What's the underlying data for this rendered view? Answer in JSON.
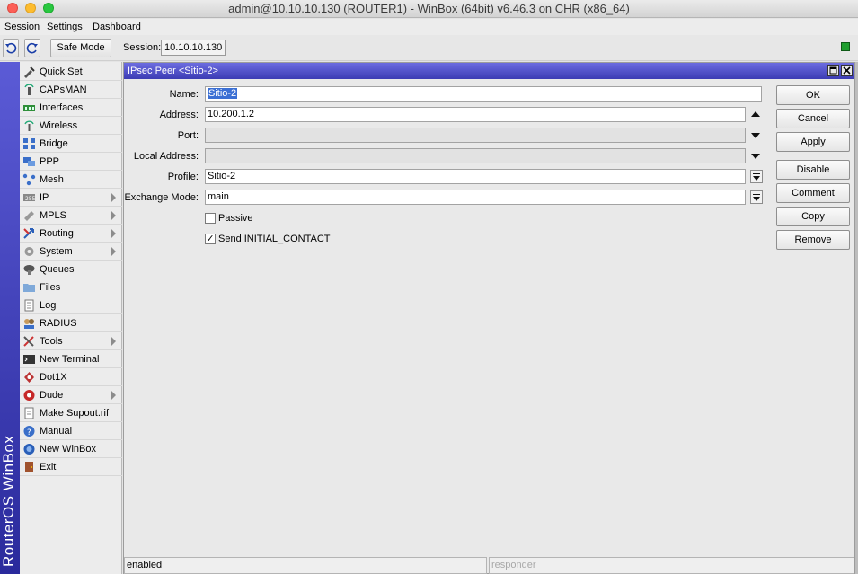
{
  "window": {
    "title": "admin@10.10.10.130 (ROUTER1) - WinBox (64bit) v6.46.3 on CHR (x86_64)"
  },
  "menubar": {
    "items": [
      "Session",
      "Settings",
      "Dashboard"
    ]
  },
  "toolbar": {
    "undo_icon": "undo-icon",
    "redo_icon": "redo-icon",
    "safe_mode_label": "Safe Mode",
    "session_label": "Session:",
    "session_value": "10.10.10.130"
  },
  "brand": {
    "text": "RouterOS WinBox"
  },
  "sidebar": {
    "items": [
      {
        "label": "Quick Set",
        "icon": "quickset-icon",
        "submenu": false
      },
      {
        "label": "CAPsMAN",
        "icon": "capsman-icon",
        "submenu": false
      },
      {
        "label": "Interfaces",
        "icon": "interfaces-icon",
        "submenu": false
      },
      {
        "label": "Wireless",
        "icon": "wireless-icon",
        "submenu": false
      },
      {
        "label": "Bridge",
        "icon": "bridge-icon",
        "submenu": false
      },
      {
        "label": "PPP",
        "icon": "ppp-icon",
        "submenu": false
      },
      {
        "label": "Mesh",
        "icon": "mesh-icon",
        "submenu": false
      },
      {
        "label": "IP",
        "icon": "ip-icon",
        "submenu": true
      },
      {
        "label": "MPLS",
        "icon": "mpls-icon",
        "submenu": true
      },
      {
        "label": "Routing",
        "icon": "routing-icon",
        "submenu": true
      },
      {
        "label": "System",
        "icon": "system-icon",
        "submenu": true
      },
      {
        "label": "Queues",
        "icon": "queues-icon",
        "submenu": false
      },
      {
        "label": "Files",
        "icon": "files-icon",
        "submenu": false
      },
      {
        "label": "Log",
        "icon": "log-icon",
        "submenu": false
      },
      {
        "label": "RADIUS",
        "icon": "radius-icon",
        "submenu": false
      },
      {
        "label": "Tools",
        "icon": "tools-icon",
        "submenu": true
      },
      {
        "label": "New Terminal",
        "icon": "terminal-icon",
        "submenu": false
      },
      {
        "label": "Dot1X",
        "icon": "dot1x-icon",
        "submenu": false
      },
      {
        "label": "Dude",
        "icon": "dude-icon",
        "submenu": true
      },
      {
        "label": "Make Supout.rif",
        "icon": "supout-icon",
        "submenu": false
      },
      {
        "label": "Manual",
        "icon": "manual-icon",
        "submenu": false
      },
      {
        "label": "New WinBox",
        "icon": "winbox-icon",
        "submenu": false
      },
      {
        "label": "Exit",
        "icon": "exit-icon",
        "submenu": false
      }
    ]
  },
  "dialog": {
    "title": "IPsec Peer <Sitio-2>",
    "fields": {
      "name_label": "Name:",
      "name_value": "Sitio-2",
      "address_label": "Address:",
      "address_value": "10.200.1.2",
      "port_label": "Port:",
      "port_value": "",
      "local_address_label": "Local Address:",
      "local_address_value": "",
      "profile_label": "Profile:",
      "profile_value": "Sitio-2",
      "exchange_mode_label": "Exchange Mode:",
      "exchange_mode_value": "main"
    },
    "checkboxes": {
      "passive_label": "Passive",
      "passive_checked": false,
      "send_initial_contact_label": "Send INITIAL_CONTACT",
      "send_initial_contact_checked": true,
      "check_mark": "✓"
    },
    "buttons": {
      "ok": "OK",
      "cancel": "Cancel",
      "apply": "Apply",
      "disable": "Disable",
      "comment": "Comment",
      "copy": "Copy",
      "remove": "Remove"
    },
    "status": {
      "left": "enabled",
      "right": "responder"
    },
    "colors": {
      "title_bar": "#4c4cc8",
      "selection": "#3b6fd4"
    }
  }
}
